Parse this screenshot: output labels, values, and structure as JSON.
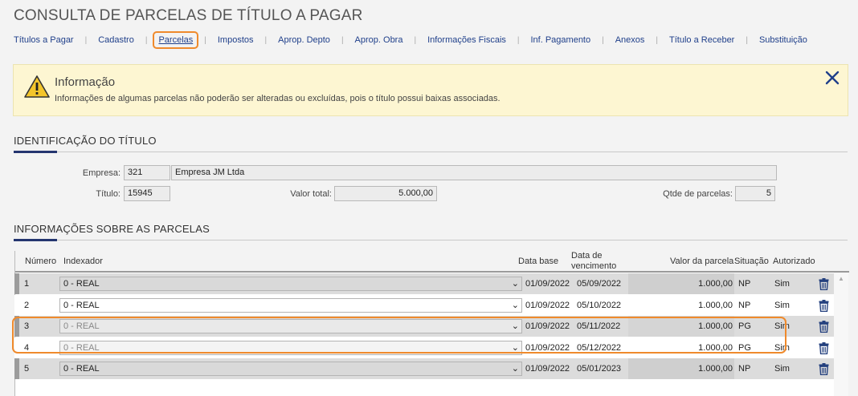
{
  "page": {
    "title": "CONSULTA DE PARCELAS DE TÍTULO A PAGAR"
  },
  "tabs": [
    {
      "label": "Títulos a Pagar"
    },
    {
      "label": "Cadastro"
    },
    {
      "label": "Parcelas",
      "active": true
    },
    {
      "label": "Impostos"
    },
    {
      "label": "Aprop. Depto"
    },
    {
      "label": "Aprop. Obra"
    },
    {
      "label": "Informações Fiscais"
    },
    {
      "label": "Inf. Pagamento"
    },
    {
      "label": "Anexos"
    },
    {
      "label": "Título a Receber"
    },
    {
      "label": "Substituição"
    }
  ],
  "alert": {
    "title": "Informação",
    "message": "Informações de algumas parcelas não poderão ser alteradas ou excluídas, pois o título possui baixas associadas.",
    "icon": "warning-icon",
    "close_icon": "close-icon"
  },
  "identificacao": {
    "section_title": "IDENTIFICAÇÃO DO TÍTULO",
    "empresa_label": "Empresa:",
    "empresa_code": "321",
    "empresa_name": "Empresa JM Ltda",
    "titulo_label": "Título:",
    "titulo_value": "15945",
    "valor_total_label": "Valor total:",
    "valor_total_value": "5.000,00",
    "qtde_label": "Qtde de parcelas:",
    "qtde_value": "5"
  },
  "parcelas": {
    "section_title": "INFORMAÇÕES SOBRE AS PARCELAS",
    "columns": {
      "numero": "Número",
      "indexador": "Indexador",
      "data_base": "Data base",
      "data_venc_1": "Data de",
      "data_venc_2": "vencimento",
      "valor": "Valor da parcela",
      "situacao": "Situação",
      "autorizado": "Autorizado"
    },
    "rows": [
      {
        "numero": "1",
        "indexador": "0 - REAL",
        "data_base": "01/09/2022",
        "vencimento": "05/09/2022",
        "valor": "1.000,00",
        "situacao": "NP",
        "autorizado": "Sim"
      },
      {
        "numero": "2",
        "indexador": "0 - REAL",
        "data_base": "01/09/2022",
        "vencimento": "05/10/2022",
        "valor": "1.000,00",
        "situacao": "NP",
        "autorizado": "Sim"
      },
      {
        "numero": "3",
        "indexador": "0 - REAL",
        "data_base": "01/09/2022",
        "vencimento": "05/11/2022",
        "valor": "1.000,00",
        "situacao": "PG",
        "autorizado": "Sim"
      },
      {
        "numero": "4",
        "indexador": "0 - REAL",
        "data_base": "01/09/2022",
        "vencimento": "05/12/2022",
        "valor": "1.000,00",
        "situacao": "PG",
        "autorizado": "Sim"
      },
      {
        "numero": "5",
        "indexador": "0 - REAL",
        "data_base": "01/09/2022",
        "vencimento": "05/01/2023",
        "valor": "1.000,00",
        "situacao": "NP",
        "autorizado": "Sim"
      }
    ]
  },
  "colors": {
    "accent": "#ef8a2c",
    "link": "#1f3f8a",
    "trash": "#24407e"
  }
}
